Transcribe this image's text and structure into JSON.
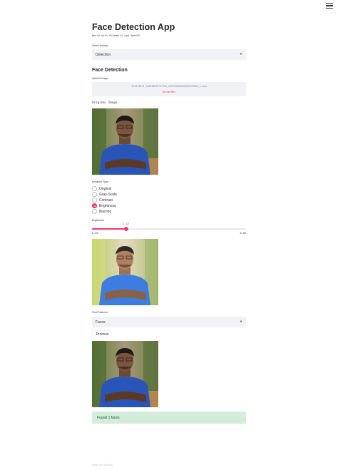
{
  "app": {
    "menu_icon": "hamburger-icon",
    "title": "Face Detection App",
    "subtitle": "Build with Streamlit and OpenCV"
  },
  "activity": {
    "label": "Select Activity",
    "selected": "Detection",
    "caret_icon": "caret-down-icon"
  },
  "section": {
    "heading": "Face Detection"
  },
  "uploader": {
    "label": "Upload Image",
    "file_name": "324076019_318248616747729_429733666260489370460_n.png",
    "browse_label": "Browse files"
  },
  "original": {
    "label": "Original Image",
    "image_icon": "portrait-photo"
  },
  "enhance": {
    "label": "Enhance Type",
    "options": [
      "Original",
      "Gray-Scale",
      "Contrast",
      "Brightness",
      "Blurring"
    ],
    "selected_index": 3
  },
  "brightness": {
    "label": "Brightness",
    "value": "2.10",
    "min": "0.50",
    "max": "3.50",
    "fraction": 0.22
  },
  "features": {
    "label": "Find Features",
    "selected": "Faces"
  },
  "process": {
    "label": "Process"
  },
  "result": {
    "message": "Found 1 faces"
  },
  "footer": {
    "text": "Made with Streamlit"
  },
  "colors": {
    "accent": "#f63366",
    "select_bg": "#f0f2f6",
    "success_bg": "#d4edda",
    "success_text": "#155724"
  }
}
